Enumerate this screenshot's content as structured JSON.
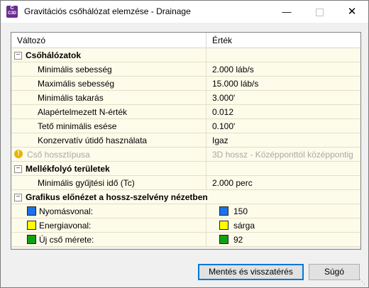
{
  "window": {
    "title": "Gravitációs csőhálózat elemzése - Drainage",
    "app_icon_letter": "C",
    "app_icon_sub": "C3D"
  },
  "grid": {
    "col_variable": "Változó",
    "col_value": "Érték",
    "cats": {
      "network": "Csőhálózatok",
      "catchment": "Mellékfolyó területek",
      "graph": "Grafikus előnézet a hossz-szelvény nézetben"
    },
    "rows": {
      "min_velocity": {
        "name": "Minimális sebesség",
        "value": "2.000 láb/s"
      },
      "max_velocity": {
        "name": "Maximális sebesség",
        "value": "15.000 láb/s"
      },
      "min_cover": {
        "name": "Minimális takarás",
        "value": "3.000'"
      },
      "default_n": {
        "name": "Alapértelmezett N-érték",
        "value": "0.012"
      },
      "min_top_slope": {
        "name": "Tető minimális esése",
        "value": "0.100'"
      },
      "conservative_tt": {
        "name": "Konzervatív útidő használata",
        "value": "Igaz"
      },
      "pipe_length_type": {
        "name": "Cső hossztípusa",
        "value": "3D hossz - Középponttól középpontig"
      },
      "min_tc": {
        "name": "Minimális gyűjtési idő (Tc)",
        "value": "2.000 perc"
      },
      "pressure_line": {
        "name": "Nyomásvonal:",
        "value": "150",
        "color": "#1a73e8"
      },
      "energy_line": {
        "name": "Energiavonal:",
        "value": "sárga",
        "color": "#ffff00"
      },
      "new_pipe_size": {
        "name": "Új cső mérete:",
        "value": "92",
        "color": "#12a012"
      }
    }
  },
  "buttons": {
    "save_return": "Mentés és visszatérés",
    "help": "Súgó"
  }
}
